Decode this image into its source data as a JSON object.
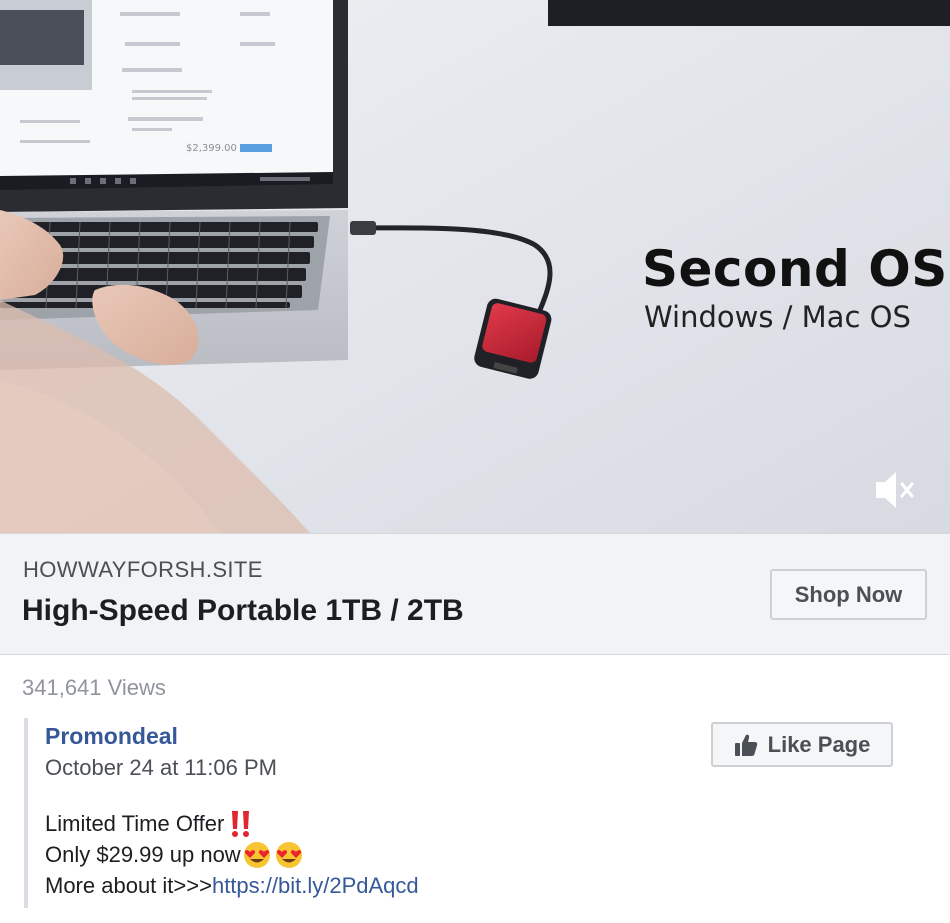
{
  "video": {
    "overlay_title": "Second OS",
    "overlay_subtitle": "Windows / Mac OS",
    "screen_price": "$2,399.00",
    "mute_icon": "speaker-muted-icon"
  },
  "link_preview": {
    "domain": "HOWWAYFORSH.SITE",
    "headline": "High-Speed Portable 1TB / 2TB",
    "cta_label": "Shop Now"
  },
  "stats": {
    "views": "341,641 Views"
  },
  "post": {
    "page_name": "Promondeal",
    "date": "October 24 at 11:06 PM",
    "like_label": "Like Page",
    "like_icon": "thumbs-up-icon",
    "lines": {
      "line1": "Limited Time Offer",
      "line2": "Only $29.99 up now",
      "line3_prefix": "More about it>>>",
      "link": "https://bit.ly/2PdAqcd"
    }
  },
  "colors": {
    "link_blue": "#365899",
    "muted_text": "#90949c",
    "bar_bg": "#f2f3f5"
  }
}
